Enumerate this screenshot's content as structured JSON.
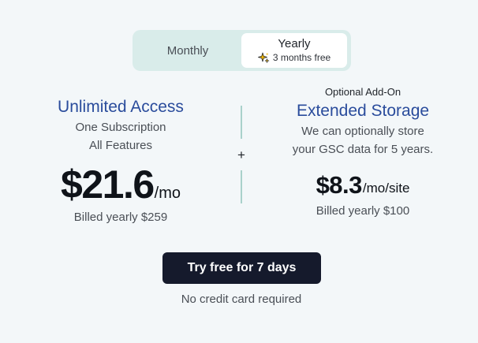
{
  "billing_toggle": {
    "monthly_label": "Monthly",
    "yearly_label": "Yearly",
    "yearly_promo": "3 months free",
    "selected": "Yearly",
    "promo_icon": "sparkle-icon"
  },
  "plan": {
    "title": "Unlimited Access",
    "line1": "One Subscription",
    "line2": "All Features",
    "price": "$21.6",
    "price_unit": "/mo",
    "billed": "Billed yearly $259"
  },
  "combiner": "+",
  "addon": {
    "badge": "Optional Add-On",
    "title": "Extended Storage",
    "line1": "We can optionally store",
    "line2": "your GSC data for 5 years.",
    "price": "$8.3",
    "price_unit": "/mo/site",
    "billed": "Billed yearly $100"
  },
  "cta": {
    "label": "Try free for 7 days",
    "note": "No credit card required"
  },
  "colors": {
    "background": "#f3f7f9",
    "toggle_bg": "#d9ecea",
    "title_blue": "#2a4c9c",
    "button_bg": "#151a2c",
    "divider": "#a9d1cb"
  }
}
